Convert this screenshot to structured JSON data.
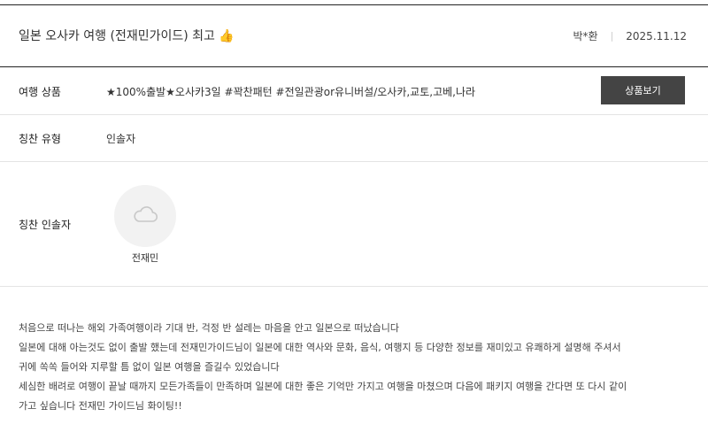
{
  "header": {
    "title": "일본 오사카 여행 (전재민가이드) 최고 👍",
    "author": "박*환",
    "date": "2025.11.12"
  },
  "rows": {
    "product_label": "여행 상품",
    "product_value": "★100%출발★오사카3일 #꽉찬패턴 #전일관광or유니버설/오사카,교토,고베,나라",
    "product_button": "상품보기",
    "type_label": "칭찬 유형",
    "type_value": "인솔자",
    "guide_label": "칭찬 인솔자",
    "guide_name": "전재민"
  },
  "review": {
    "lines": [
      "처음으로 떠나는 해외 가족여행이라 기대 반, 걱정 반 설레는 마음을 안고 일본으로 떠났습니다",
      "일본에 대해 아는것도 없이 출발 했는데 전재민가이드님이 일본에 대한 역사와 문화, 음식, 여행지 등 다양한 정보를 재미있고 유쾌하게 설명해 주셔서",
      "귀에 쏙쏙 들어와 지루할 틈 없이 일본 여행을 즐길수 있었습니다",
      "세심한 배려로 여행이 끝날 때까지 모든가족들이 만족하며 일본에 대한 좋은 기억만 가지고 여행을 마쳤으며 다음에 패키지 여행을 간다면 또 다시 같이",
      "가고 싶습니다 전재민 가이드님 화이팅!!"
    ]
  },
  "icons": {
    "avatar": "cloud-icon"
  }
}
